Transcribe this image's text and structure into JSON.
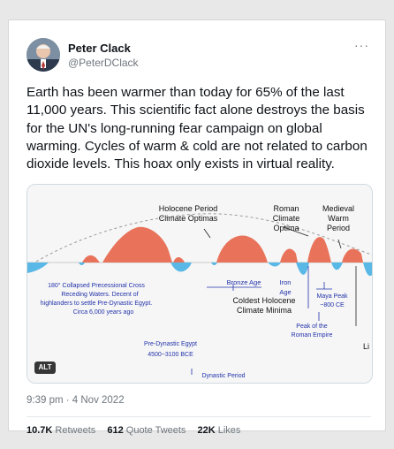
{
  "tweet": {
    "author_name": "Peter Clack",
    "author_handle": "@PeterDClack",
    "more_icon": "more-horizontal-icon",
    "text": "Earth has been warmer than today for 65% of the last 11,000 years. This scientific fact alone destroys the basis for the UN's long-running fear campaign on global warming. Cycles of warm & cold are not related to carbon dioxide levels. This hoax only exists in virtual reality.",
    "timestamp": "9:39 pm · 4 Nov 2022",
    "stats": {
      "retweets_count": "10.7K",
      "retweets_label": "Retweets",
      "quotes_count": "612",
      "quotes_label": "Quote Tweets",
      "likes_count": "22K",
      "likes_label": "Likes"
    }
  },
  "media": {
    "alt_badge": "ALT",
    "labels": {
      "holocene_1": "Holocene Period",
      "holocene_2": "Climate Optimas",
      "roman_1": "Roman",
      "roman_2": "Climate",
      "roman_3": "Optima",
      "medieval_1": "Medieval",
      "medieval_2": "Warm",
      "medieval_3": "Period",
      "collapse_1": "180° Collapsed Precessional Cross",
      "collapse_2": "Receding Waters. Decent of",
      "collapse_3": "highlanders to settle Pre-Dynastic Egypt.",
      "collapse_4": "Circa 6,000 years ago",
      "bronze": "Bronze Age",
      "iron_1": "Iron",
      "iron_2": "Age",
      "coldest_1": "Coldest Holocene",
      "coldest_2": "Climate Minima",
      "maya_1": "Maya Peak",
      "maya_2": "~800 CE",
      "peak_roman_1": "Peak of the",
      "peak_roman_2": "Roman Empire",
      "predynastic_1": "Pre-Dynastic Egypt",
      "predynastic_2": "4500~3100 BCE",
      "dynastic": "Dynastic Period",
      "edge": "Li"
    },
    "colors": {
      "warm": "#e8735a",
      "cold": "#59b8e6",
      "annotation": "#2233aa"
    }
  }
}
